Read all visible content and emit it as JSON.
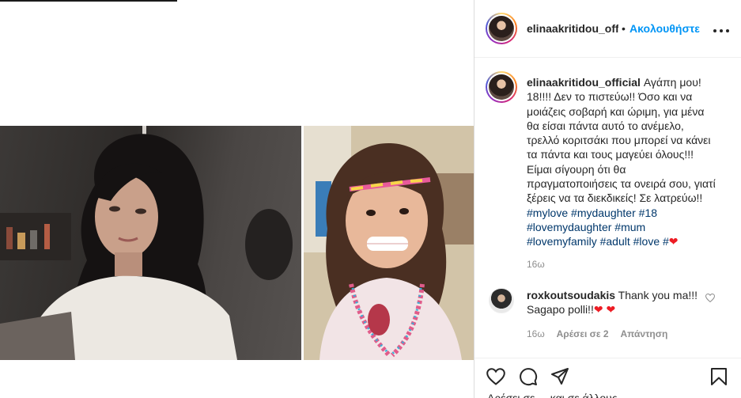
{
  "post": {
    "username": "elinaakritidou_official",
    "username_truncated": "elinaakritidou_offic",
    "follow_dot": "•",
    "follow_label": "Ακολουθήστε",
    "more_label": "•••"
  },
  "caption": {
    "username": "elinaakritidou_official",
    "text": "Αγάπη μου! 18!!!! Δεν το πιστεύω!! Όσο και να μοιάζεις σοβαρή και ώριμη, για μένα θα είσαι πάντα αυτό το ανέμελο, τρελλό κοριτσάκι που μπορεί να κάνει τα πάντα και τους μαγεύει όλους!!! Είμαι σίγουρη ότι θα πραγματοποιήσεις τα ονειρά σου, γιατί ξέρεις να τα διεκδικείς! Σε λατρεύω!!",
    "hashtags": [
      "#mylove",
      "#mydaughter",
      "#18",
      "#lovemydaughter",
      "#mum",
      "#lovemyfamily",
      "#adult",
      "#love",
      "#"
    ],
    "emoji": "❤",
    "time": "16ω"
  },
  "comment": {
    "username": "roxkoutsoudakis",
    "text": "Thank you ma!!! Sagapo polli!!",
    "emoji": "❤ ❤",
    "time": "16ω",
    "likes": "Αρέσει σε 2",
    "reply": "Απάντηση"
  },
  "actions": {
    "like_icon": "heart-icon",
    "comment_icon": "comment-icon",
    "share_icon": "share-icon",
    "save_icon": "bookmark-icon"
  },
  "likes_line": "Αρέσει σε ... και σε άλλους",
  "colors": {
    "link": "#0095f6",
    "hashtag": "#00376b",
    "secondary_text": "#8e8e8e",
    "heart": "#ed1c24"
  }
}
